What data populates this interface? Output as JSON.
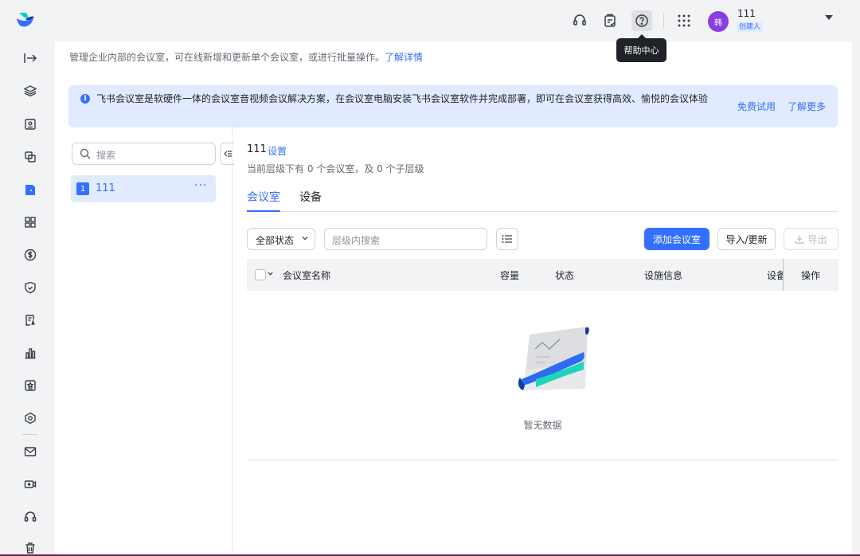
{
  "topbar": {
    "logo_icon": "feishu-logo",
    "icons": [
      "headset-icon",
      "clipboard-check-icon",
      "help-circle-icon",
      "app-grid-icon"
    ],
    "avatar_text": "韩",
    "user_name": "111",
    "user_role": "创建人",
    "tooltip": "帮助中心"
  },
  "sidebar": {
    "icons": [
      "expand-icon",
      "layers-icon",
      "id-card-icon",
      "copy-icon",
      "meeting-room-icon",
      "grid-icon",
      "dollar-icon",
      "shield-check-icon",
      "doc-text-icon",
      "bar-chart-icon",
      "badge-icon",
      "hexagon-settings-icon",
      "mail-icon",
      "video-icon",
      "headset-icon",
      "trash-icon"
    ],
    "active": "meeting-room-icon"
  },
  "main": {
    "description": "管理企业内部的会议室，可在线新增和更新单个会议室，或进行批量操作。",
    "description_link": "了解详情",
    "banner": {
      "text": "飞书会议室是软硬件一体的会议室音视频会议解决方案，在会议室电脑安装飞书会议室软件并完成部署，即可在会议室获得高效、愉悦的会议体验",
      "link_trial": "免费试用",
      "link_more": "了解更多"
    }
  },
  "tree": {
    "search_placeholder": "搜索",
    "items": [
      {
        "badge": "1",
        "label": "111",
        "more": "···"
      }
    ]
  },
  "content": {
    "title": "111",
    "setting_link": "设置",
    "subtitle": "当前层级下有 0 个会议室，及 0 个子层级",
    "tabs": [
      "会议室",
      "设备"
    ],
    "status_select": "全部状态",
    "search_placeholder": "层级内搜索",
    "add_button": "添加会议室",
    "import_button": "导入/更新",
    "export_button": "导出",
    "table_headers": [
      "会议室名称",
      "容量",
      "状态",
      "设施信息",
      "设备",
      "操作"
    ],
    "empty_text": "暂无数据"
  },
  "colors": {
    "accent": "#3370ff",
    "banner_bg": "#e1eaff",
    "avatar_bg": "#8b3fe0"
  }
}
